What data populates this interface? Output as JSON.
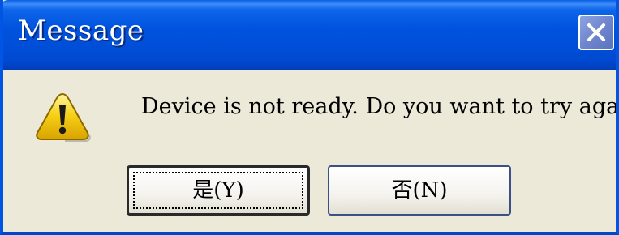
{
  "dialog": {
    "title": "Message",
    "message": "Device is not ready. Do you want to try again?",
    "icon": "warning-icon",
    "close_icon": "close-icon",
    "buttons": {
      "yes_label": "是(Y)",
      "no_label": "否(N)"
    },
    "focused_button": "yes"
  },
  "colors": {
    "titlebar": "#0053de",
    "window_body": "#ece9d8",
    "close_button": "#7187cf",
    "warning_yellow": "#f7d117"
  }
}
